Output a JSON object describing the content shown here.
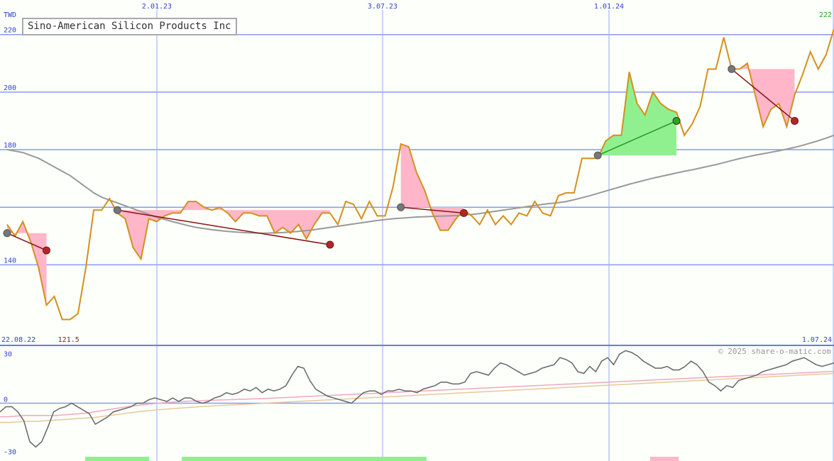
{
  "chart_data": {
    "type": "line",
    "title": "Sino-American Silicon Products Inc",
    "currency": "TWD",
    "copyright": "© 2025 share-o-matic.com",
    "x_top_ticks": [
      "2.01.23",
      "3.07.23",
      "1.01.24"
    ],
    "x_bottom_left": "22.08.22",
    "x_bottom_right": "1.07.24",
    "y_ticks": [
      140,
      160,
      180,
      200,
      220
    ],
    "y_tick_labels": [
      "140",
      "",
      "180",
      "200",
      "220"
    ],
    "ylim": [
      112,
      232
    ],
    "last_value": "222",
    "min_label": "121.5",
    "price": [
      154,
      150,
      155,
      148,
      139,
      126,
      129,
      121,
      121,
      123,
      139,
      159,
      159,
      163,
      158,
      156,
      146,
      142,
      156,
      155,
      157,
      158,
      158,
      162,
      162,
      160,
      159,
      160,
      158,
      155,
      158,
      158,
      157,
      157,
      151,
      153,
      151,
      154,
      149,
      154,
      158,
      158,
      154,
      162,
      161,
      156,
      162,
      157,
      157,
      167,
      182,
      181,
      172,
      166,
      158,
      152,
      152,
      156,
      159,
      157,
      154,
      159,
      154,
      157,
      154,
      158,
      157,
      162,
      158,
      157,
      164,
      165,
      165,
      177,
      177,
      177,
      183,
      185,
      185,
      207,
      196,
      192,
      200,
      196,
      194,
      193,
      185,
      189,
      195,
      208,
      208,
      219,
      208,
      208,
      210,
      199,
      188,
      194,
      196,
      188,
      199,
      206,
      214,
      208,
      213,
      222
    ],
    "ma_long": [
      180,
      179.5,
      179,
      178,
      177,
      175.5,
      174,
      172.5,
      171,
      169,
      167,
      165,
      163.5,
      162.5,
      161.5,
      160.5,
      159.5,
      158.5,
      157.5,
      156.5,
      155.8,
      155,
      154.3,
      153.6,
      153,
      152.6,
      152.2,
      151.9,
      151.6,
      151.4,
      151.2,
      151.1,
      151,
      151,
      151.1,
      151.2,
      151.4,
      151.6,
      151.9,
      152.2,
      152.6,
      153,
      153.4,
      153.8,
      154.2,
      154.6,
      155,
      155.4,
      155.7,
      156,
      156.2,
      156.4,
      156.6,
      156.7,
      156.8,
      156.9,
      157,
      157.1,
      157.3,
      157.5,
      157.8,
      158.2,
      158.6,
      159,
      159.4,
      159.8,
      160.2,
      160.6,
      161,
      161.3,
      161.6,
      162,
      162.6,
      163.3,
      164,
      164.8,
      165.6,
      166.4,
      167.2,
      168,
      168.7,
      169.4,
      170.1,
      170.7,
      171.3,
      171.9,
      172.5,
      173,
      173.6,
      174.2,
      174.8,
      175.5,
      176.2,
      176.9,
      177.5,
      178.1,
      178.6,
      179.1,
      179.6,
      180.2,
      180.8,
      181.5,
      182.3,
      183.1,
      184,
      185
    ],
    "trades": [
      {
        "entry_i": 0,
        "entry": 151,
        "exit_i": 5,
        "exit": 145,
        "result": "loss"
      },
      {
        "entry_i": 14,
        "entry": 159,
        "exit_i": 41,
        "exit": 147,
        "result": "loss"
      },
      {
        "entry_i": 50,
        "entry": 160,
        "exit_i": 58,
        "exit": 158,
        "result": "loss"
      },
      {
        "entry_i": 75,
        "entry": 178,
        "exit_i": 85,
        "exit": 190,
        "result": "win"
      },
      {
        "entry_i": 92,
        "entry": 208,
        "exit_i": 100,
        "exit": 190,
        "result": "loss"
      },
      {
        "entry_i": 108,
        "entry": 212,
        "exit_i": 109,
        "exit": 222,
        "result": "open"
      }
    ],
    "osc_ticks": [
      30,
      0,
      -30
    ],
    "osc_ylim": [
      -33,
      33
    ],
    "osc_main": [
      -5,
      -2,
      -2,
      -5,
      -10,
      -22,
      -25,
      -22,
      -14,
      -5,
      -3,
      -2,
      0,
      -2,
      -4,
      -6,
      -12,
      -10,
      -8,
      -5,
      -4,
      -3,
      -2,
      0,
      0,
      2,
      3,
      2,
      1,
      3,
      1,
      3,
      3,
      1,
      0,
      1,
      3,
      4,
      6,
      5,
      6,
      8,
      7,
      9,
      6,
      8,
      7,
      8,
      10,
      16,
      21,
      20,
      13,
      8,
      6,
      4,
      3,
      2,
      1,
      0,
      3,
      6,
      7,
      7,
      5,
      7,
      7,
      8,
      7,
      7,
      6,
      8,
      9,
      10,
      12,
      12,
      11,
      11,
      12,
      17,
      18,
      17,
      16,
      20,
      23,
      22,
      20,
      18,
      16,
      17,
      18,
      20,
      21,
      22,
      26,
      25,
      23,
      18,
      17,
      21,
      18,
      24,
      26,
      22,
      28,
      30,
      29,
      27,
      24,
      22,
      20,
      20,
      21,
      19,
      19,
      21,
      24,
      22,
      18,
      12,
      10,
      7,
      10,
      9,
      13,
      14,
      15,
      16,
      18,
      19,
      20,
      21,
      22,
      24,
      25,
      26,
      24,
      22,
      21,
      22,
      23
    ],
    "osc_signal": [
      -8,
      -8,
      -7.5,
      -7,
      -7,
      -7,
      -7,
      -7,
      -6.5,
      -6,
      -5.5,
      -5,
      -4,
      -3,
      -2,
      -1,
      0,
      0.8,
      1.5,
      2.2,
      2.8,
      3.3,
      3.8,
      4.2,
      4.5,
      4.7,
      5,
      5.2,
      5.4,
      5.6,
      5.8,
      6,
      6.2,
      6.4,
      6.7,
      7,
      7.3,
      7.6,
      7.9,
      8.2,
      8.5,
      8.8,
      9.1,
      9.4,
      9.7,
      10,
      10.3,
      10.6,
      10.9,
      11.2,
      11.5,
      11.8,
      12.1,
      12.4,
      12.7,
      13,
      13.3,
      13.6,
      13.9,
      14.2,
      14.5,
      14.8,
      15.1,
      15.4,
      15.7,
      16,
      16.3,
      16.6,
      16.9,
      17.2,
      17.5,
      17.8,
      18.1,
      18.4,
      18.7,
      19,
      19.3,
      19.6,
      19.9,
      20.2,
      20.5,
      20.8,
      21.1,
      21.4,
      21.7,
      22,
      22.3,
      22.6,
      22.9,
      23.2,
      23.5,
      23.8,
      24.1,
      24.4,
      24.7,
      25,
      25.3,
      25.6,
      25.9,
      26.2,
      26.5,
      26.8,
      27.1,
      27.4,
      27.7,
      28
    ],
    "osc_signal2": [
      -10,
      -10,
      -9.5,
      -9,
      -9,
      -8.5,
      -8,
      -7.5,
      -7,
      -6.5,
      -6,
      -5,
      -4,
      -3,
      -2,
      -1,
      -0.3,
      0.4,
      1,
      1.6,
      2.2,
      2.7,
      3.2,
      3.6,
      4,
      4.4,
      4.8,
      5.2,
      5.6,
      6,
      6.4,
      6.8,
      7.2,
      7.6,
      8,
      8.4,
      8.8,
      9.2,
      9.6,
      10,
      10.4,
      10.8,
      11.2,
      11.6,
      12,
      12.4,
      12.8,
      13.2,
      13.6,
      14,
      14.4,
      14.8,
      15.2,
      15.6,
      16,
      16.4,
      16.8,
      17.2,
      17.6,
      18,
      18.4,
      18.8,
      19.2,
      19.6,
      20,
      20.4,
      20.8,
      21.2,
      21.6,
      22,
      22.4,
      22.8,
      23.2,
      23.6,
      24,
      24.4,
      24.8,
      25.2,
      25.6,
      26,
      26.4,
      26.8,
      27.2,
      27.6,
      28,
      28.4,
      28.8,
      29.2,
      29.6,
      30
    ]
  }
}
